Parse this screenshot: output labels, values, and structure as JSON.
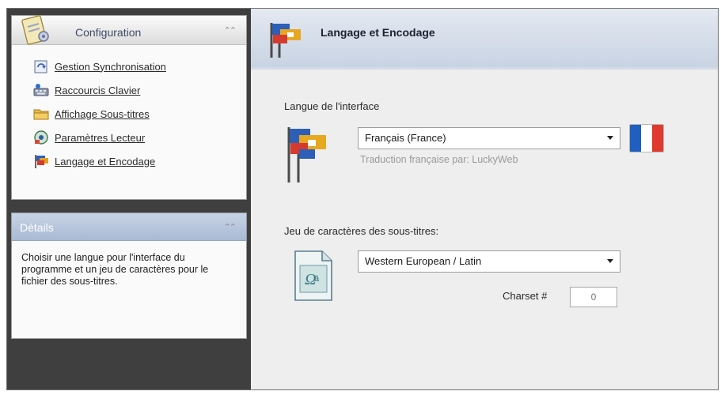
{
  "sidebar": {
    "config_title": "Configuration",
    "items": [
      {
        "label": "Gestion Synchronisation",
        "icon": "sync-icon"
      },
      {
        "label": "Raccourcis Clavier",
        "icon": "keyboard-icon"
      },
      {
        "label": "Affichage Sous-titres",
        "icon": "folder-icon"
      },
      {
        "label": "Paramètres Lecteur",
        "icon": "player-icon"
      },
      {
        "label": "Langage et Encodage",
        "icon": "flags-icon"
      }
    ],
    "details_title": "Détails",
    "details_text": "Choisir une langue pour l'interface du programme et un jeu de caractères pour le fichier des sous-titres."
  },
  "main": {
    "title": "Langage et Encodage",
    "interface_label": "Langue de l'interface",
    "language": {
      "value": "Français (France)"
    },
    "translation_credit": "Traduction française par: LuckyWeb",
    "charset_section_label": "Jeu de caractères des sous-titres:",
    "encoding": {
      "value": "Western European / Latin"
    },
    "charset_label": "Charset #",
    "charset_value": "0"
  },
  "colors": {
    "flag_blue": "#1f5fbf",
    "flag_white": "#ffffff",
    "flag_red": "#e0392d",
    "details_header": "#b2c2da"
  }
}
